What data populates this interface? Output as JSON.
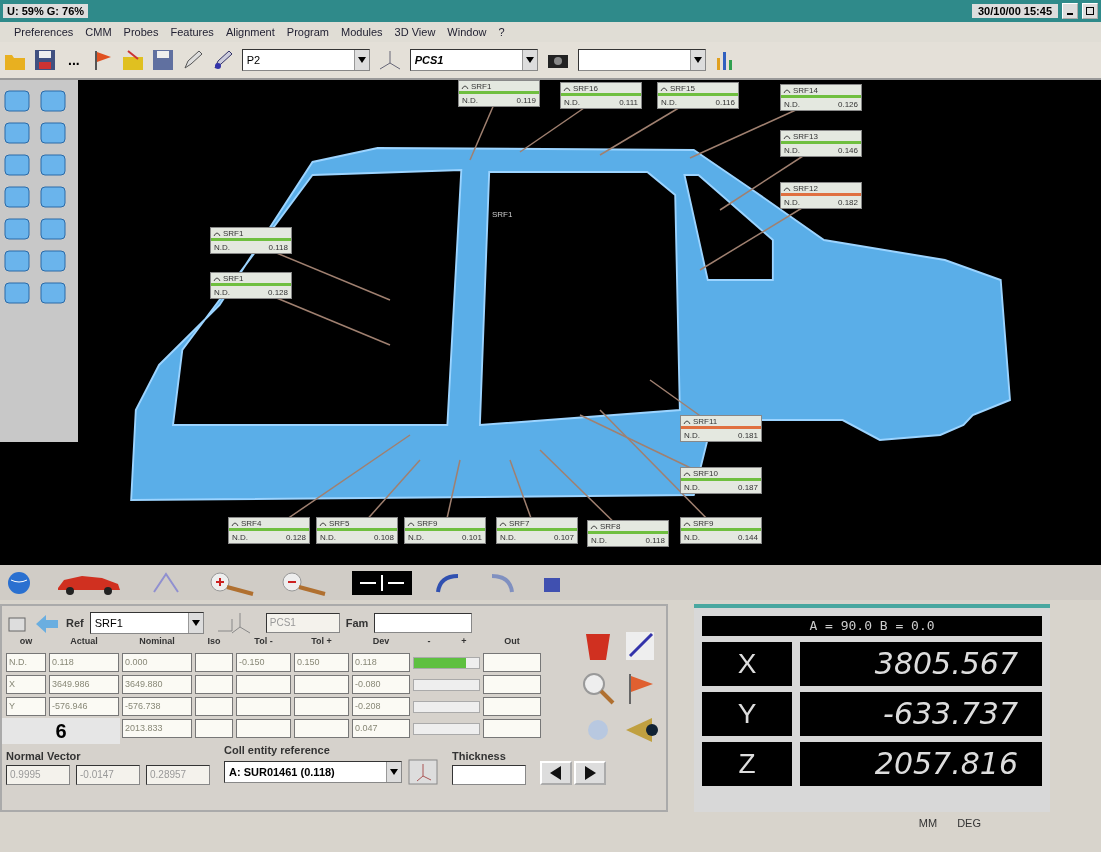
{
  "title_bar": {
    "usage": "U: 59% G: 76%",
    "datetime": "30/10/00 15:45"
  },
  "menu": [
    "Preferences",
    "CMM",
    "Probes",
    "Features",
    "Alignment",
    "Program",
    "Modules",
    "3D View",
    "Window",
    "?"
  ],
  "toolbar": {
    "more": "...",
    "probe": "P2",
    "alignment": "PCS1"
  },
  "pillar_label": "SRF1",
  "callouts": [
    {
      "name": "SRF1",
      "label": "N.D.",
      "value": "0.119",
      "color": "#6fbf3f"
    },
    {
      "name": "SRF16",
      "label": "N.D.",
      "value": "0.111",
      "color": "#6fbf3f"
    },
    {
      "name": "SRF15",
      "label": "N.D.",
      "value": "0.116",
      "color": "#6fbf3f"
    },
    {
      "name": "SRF14",
      "label": "N.D.",
      "value": "0.126",
      "color": "#6fbf3f"
    },
    {
      "name": "SRF13",
      "label": "N.D.",
      "value": "0.146",
      "color": "#6fbf3f"
    },
    {
      "name": "SRF12",
      "label": "N.D.",
      "value": "0.182",
      "color": "#e07040"
    },
    {
      "name": "SRF1",
      "label": "N.D.",
      "value": "0.118",
      "color": "#6fbf3f"
    },
    {
      "name": "SRF1",
      "label": "N.D.",
      "value": "0.128",
      "color": "#6fbf3f"
    },
    {
      "name": "SRF11",
      "label": "N.D.",
      "value": "0.181",
      "color": "#e07040"
    },
    {
      "name": "SRF10",
      "label": "N.D.",
      "value": "0.187",
      "color": "#6fbf3f"
    },
    {
      "name": "SRF4",
      "label": "N.D.",
      "value": "0.128",
      "color": "#6fbf3f"
    },
    {
      "name": "SRF5",
      "label": "N.D.",
      "value": "0.108",
      "color": "#6fbf3f"
    },
    {
      "name": "SRF9",
      "label": "N.D.",
      "value": "0.101",
      "color": "#6fbf3f"
    },
    {
      "name": "SRF7",
      "label": "N.D.",
      "value": "0.107",
      "color": "#6fbf3f"
    },
    {
      "name": "SRF8",
      "label": "N.D.",
      "value": "0.118",
      "color": "#6fbf3f"
    },
    {
      "name": "SRF9",
      "label": "N.D.",
      "value": "0.144",
      "color": "#6fbf3f"
    }
  ],
  "tool_panel": {
    "ref_label": "Ref",
    "ref": "SRF1",
    "alignment": "PCS1",
    "fam_label": "Fam"
  },
  "table": {
    "columns": [
      "ow",
      "Actual",
      "Nominal",
      "Iso",
      "Tol -",
      "Tol +",
      "Dev",
      "-",
      "+",
      "Out"
    ],
    "rows": [
      {
        "cells": [
          "N.D.",
          "0.118",
          "0.000",
          null,
          "-0.150",
          "0.150",
          "0.118"
        ],
        "level": 0.8
      },
      {
        "cells": [
          "X",
          "3649.986",
          "3649.880",
          null,
          null,
          null,
          "-0.080"
        ]
      },
      {
        "cells": [
          "Y",
          "-576.946",
          "-576.738",
          null,
          null,
          null,
          "-0.208"
        ]
      },
      {
        "cells": [
          null,
          null,
          "2013.833",
          null,
          null,
          null,
          "0.047"
        ]
      }
    ]
  },
  "figure_label": "6",
  "normal_vector": {
    "label": "Normal Vector",
    "values": [
      "0.9995",
      "-0.0147",
      "0.28957"
    ]
  },
  "coll_ref": {
    "label": "Coll entity reference",
    "value": "A: SUR01461 (0.118)"
  },
  "thickness": {
    "label": "Thickness"
  },
  "readout": {
    "angles": "A = 90.0 B = 0.0",
    "axes": [
      {
        "axis": "X",
        "value": "3805.567"
      },
      {
        "axis": "Y",
        "value": "-633.737"
      },
      {
        "axis": "Z",
        "value": "2057.816"
      }
    ]
  },
  "status_bar": [
    "MM",
    "DEG"
  ]
}
